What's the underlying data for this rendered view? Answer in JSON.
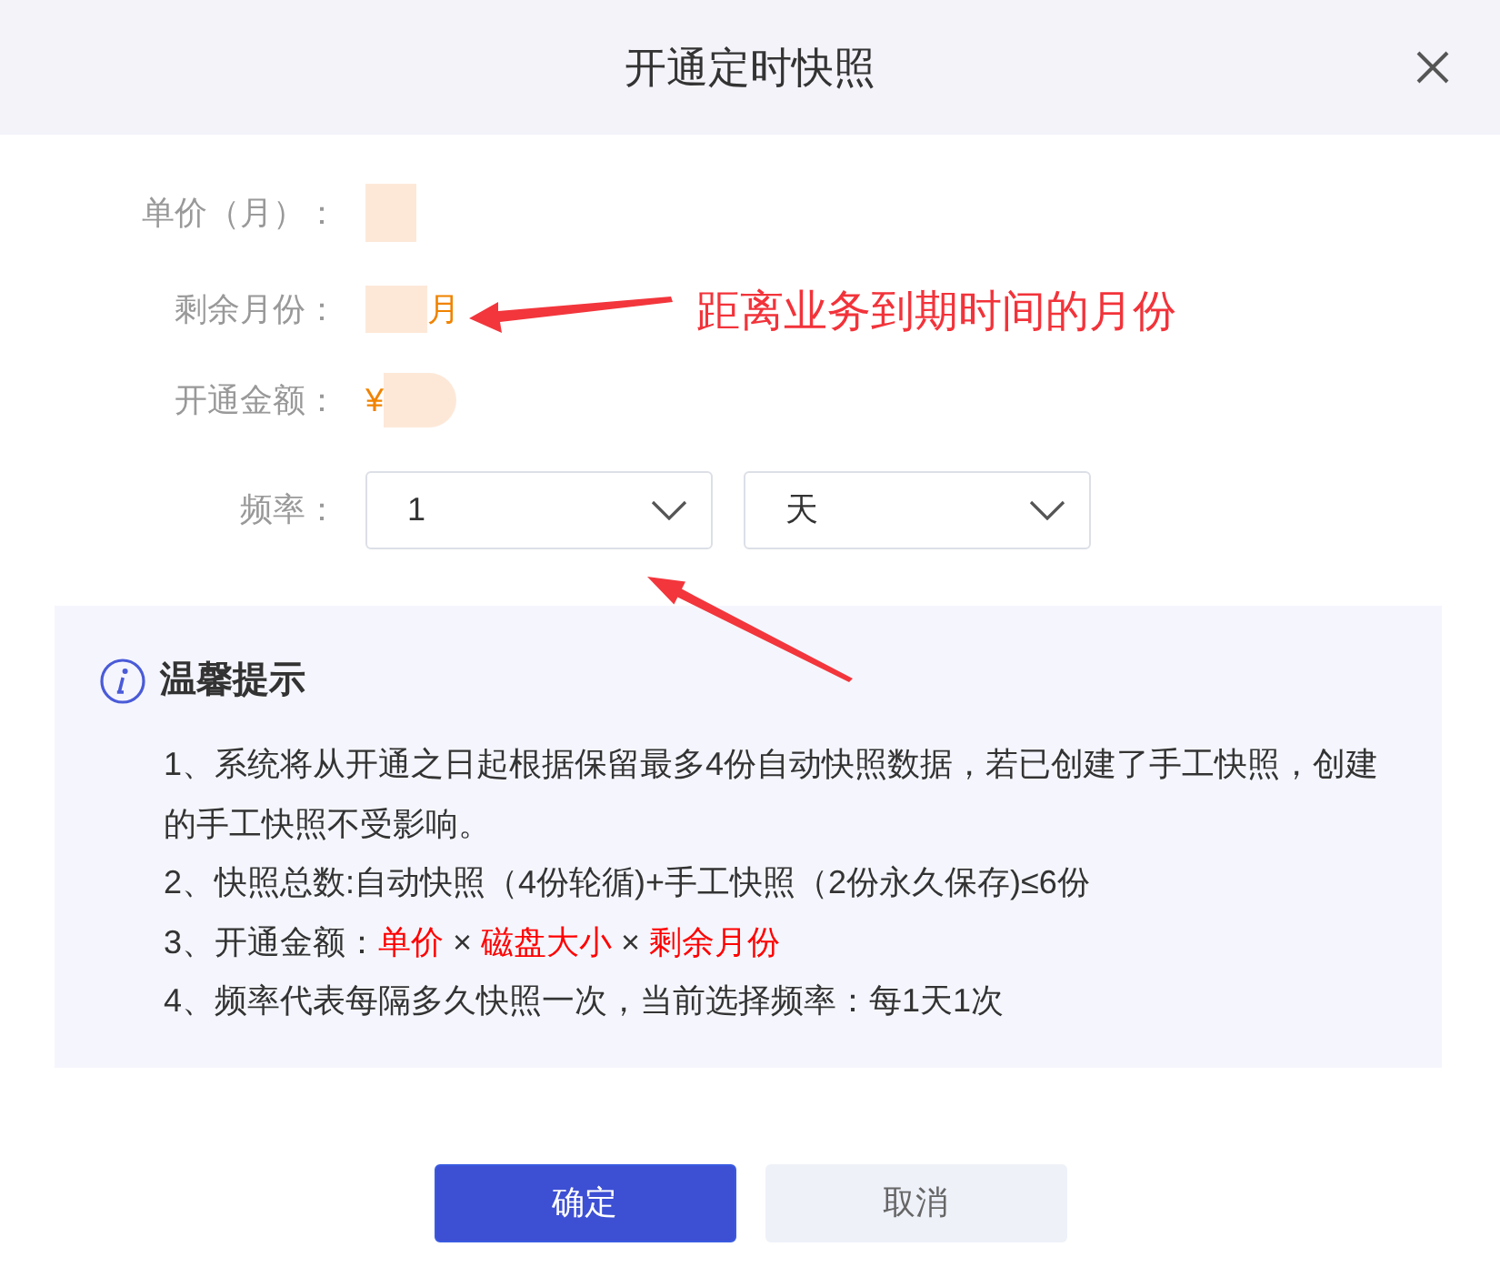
{
  "dialog": {
    "title": "开通定时快照"
  },
  "fields": [
    {
      "label": "单价（月）：",
      "kind": "masked"
    },
    {
      "label": "剩余月份：",
      "kind": "masked_then_text",
      "value": "月"
    },
    {
      "label": "开通金额：",
      "kind": "text_then_masked",
      "value": "¥"
    }
  ],
  "frequency": {
    "label": "频率：",
    "selects": [
      {
        "value": "1"
      },
      {
        "value": "天"
      }
    ]
  },
  "tips": {
    "title": "温馨提示",
    "items": [
      {
        "segments": [
          {
            "text": "1、系统将从开通之日起根据保留最多4份自动快照数据，若已创建了手工快照，创建的手工快照不受影响。",
            "highlight": false
          }
        ]
      },
      {
        "segments": [
          {
            "text": "2、快照总数:自动快照（4份轮循)+手工快照（2份永久保存)≤6份",
            "highlight": false
          }
        ]
      },
      {
        "segments": [
          {
            "text": "3、开通金额：",
            "highlight": false
          },
          {
            "text": "单价",
            "highlight": true
          },
          {
            "text": " × ",
            "highlight": false
          },
          {
            "text": "磁盘大小",
            "highlight": true
          },
          {
            "text": " × ",
            "highlight": false
          },
          {
            "text": "剩余月份",
            "highlight": true
          }
        ]
      },
      {
        "segments": [
          {
            "text": "4、频率代表每隔多久快照一次，当前选择频率：每1天1次",
            "highlight": false
          }
        ]
      }
    ]
  },
  "buttons": [
    {
      "label": "确定",
      "kind": "primary"
    },
    {
      "label": "取消",
      "kind": "secondary"
    }
  ],
  "annotation": {
    "text": "距离业务到期时间的月份"
  }
}
